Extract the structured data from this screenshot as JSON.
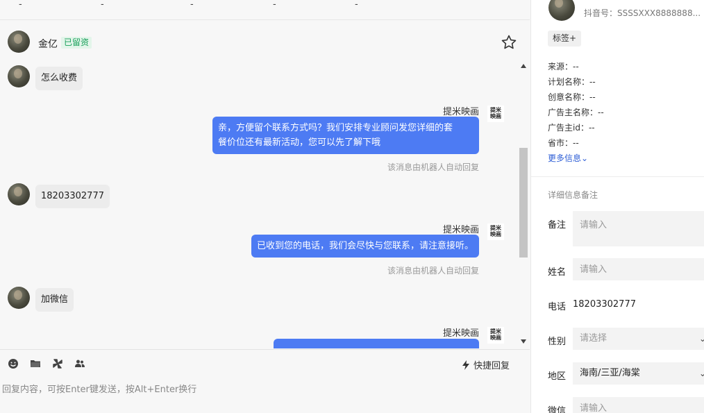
{
  "top_strip": {
    "marks": [
      "-",
      "-",
      "-",
      "-",
      "-"
    ]
  },
  "chat_header": {
    "name": "金亿",
    "badge": "已留资"
  },
  "messages": [
    {
      "dir": "in",
      "text": "怎么收费"
    },
    {
      "dir": "out",
      "sender": "提米映画",
      "lines": [
        "亲，方便留个联系方式吗？我们安排专业顾问发您详细的套",
        "餐价位还有最新活动，您可以先了解下哦"
      ],
      "note": "该消息由机器人自动回复"
    },
    {
      "dir": "in",
      "text": "18203302777"
    },
    {
      "dir": "out",
      "sender": "提米映画",
      "lines": [
        "已收到您的电话，我们会尽快与您联系，请注意接听。"
      ],
      "note": "该消息由机器人自动回复"
    },
    {
      "dir": "in",
      "text": "加微信"
    },
    {
      "dir": "out",
      "sender": "提米映画"
    }
  ],
  "logo_text": [
    "提米",
    "映画"
  ],
  "composer": {
    "quick_reply": "快捷回复",
    "placeholder": "回复内容，可按Enter键发送，按Alt+Enter换行"
  },
  "panel": {
    "douyin": "抖音号：SSSSXXX8888888...",
    "tag_button": "标签+",
    "info": [
      {
        "label": "来源：",
        "value": "--"
      },
      {
        "label": "计划名称：",
        "value": "--"
      },
      {
        "label": "创意名称：",
        "value": "--"
      },
      {
        "label": "广告主名称：",
        "value": "--"
      },
      {
        "label": "广告主id：",
        "value": "--"
      },
      {
        "label": "省市：",
        "value": "--"
      }
    ],
    "more_info": "更多信息⌄",
    "section_title": "详细信息备注",
    "fields": {
      "remark_label": "备注",
      "remark_placeholder": "请输入",
      "name_label": "姓名",
      "name_placeholder": "请输入",
      "phone_label": "电话",
      "phone_value": "18203302777",
      "gender_label": "性别",
      "gender_placeholder": "请选择",
      "region_label": "地区",
      "region_value": "海南/三亚/海棠",
      "wechat_label": "微信",
      "wechat_placeholder": "请输入"
    }
  },
  "colors": {
    "accent": "#4d7bf3",
    "badge_green": "#19a05b",
    "link": "#2f5fd6"
  },
  "icons": [
    "star-icon",
    "emoji-icon",
    "folder-icon",
    "pinwheel-icon",
    "contacts-icon",
    "lightning-icon",
    "chevron-down-icon"
  ]
}
